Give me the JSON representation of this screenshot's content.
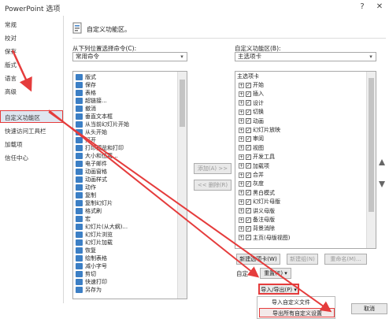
{
  "window": {
    "title": "PowerPoint 选项",
    "help_glyph": "?",
    "close_glyph": "✕"
  },
  "sidebar": {
    "items": [
      {
        "label": "常规"
      },
      {
        "label": "校对"
      },
      {
        "label": "保存"
      },
      {
        "label": "版式"
      },
      {
        "label": "语言"
      },
      {
        "label": "高级"
      },
      {
        "label": "自定义功能区"
      },
      {
        "label": "快速访问工具栏"
      },
      {
        "label": "加载项"
      },
      {
        "label": "信任中心"
      }
    ]
  },
  "header": {
    "title": "自定义功能区。"
  },
  "left_panel": {
    "label": "从下列位置选择命令(C):",
    "dropdown_value": "常用命令",
    "commands": [
      "版式",
      "保存",
      "表格",
      "超链接...",
      "撤消",
      "垂直文本框",
      "从当前幻灯片开始",
      "从头开始",
      "打开",
      "打印预览和打印",
      "大小和位置...",
      "电子邮件",
      "动画窗格",
      "动画样式",
      "动作",
      "复制",
      "复制幻灯片",
      "格式刷",
      "宏",
      "幻灯片(从大纲)...",
      "幻灯片浏览",
      "幻灯片加载",
      "恢复",
      "绘制表格",
      "减小字号",
      "剪切",
      "快速打印",
      "另存为"
    ]
  },
  "middle": {
    "add": "添加(A) >>",
    "remove": "<< 删除(R)"
  },
  "right_panel": {
    "label": "自定义功能区(B):",
    "dropdown_value": "主选项卡",
    "tree_header": "主选项卡",
    "tabs": [
      "开始",
      "插入",
      "设计",
      "切换",
      "动画",
      "幻灯片放映",
      "审阅",
      "视图",
      "开发工具",
      "加载项",
      "合并",
      "灰度",
      "黑白模式",
      "幻灯片母版",
      "讲义母版",
      "备注母版",
      "背景消除",
      "主页(母版视图)"
    ]
  },
  "bottom": {
    "new_tab": "新建选项卡(W)",
    "new_group": "新建组(N)",
    "rename": "重命名(M)...",
    "custom_label": "自定",
    "reset": "重置(E) ▾",
    "import_export": "导入/导出(P) ▾",
    "cancel": "取消"
  },
  "menu": {
    "import": "导入自定义文件",
    "export": "导出所有自定义设置"
  },
  "colors": {
    "annotation": "#e53c3c",
    "selected_bg": "#dfe6f0"
  }
}
